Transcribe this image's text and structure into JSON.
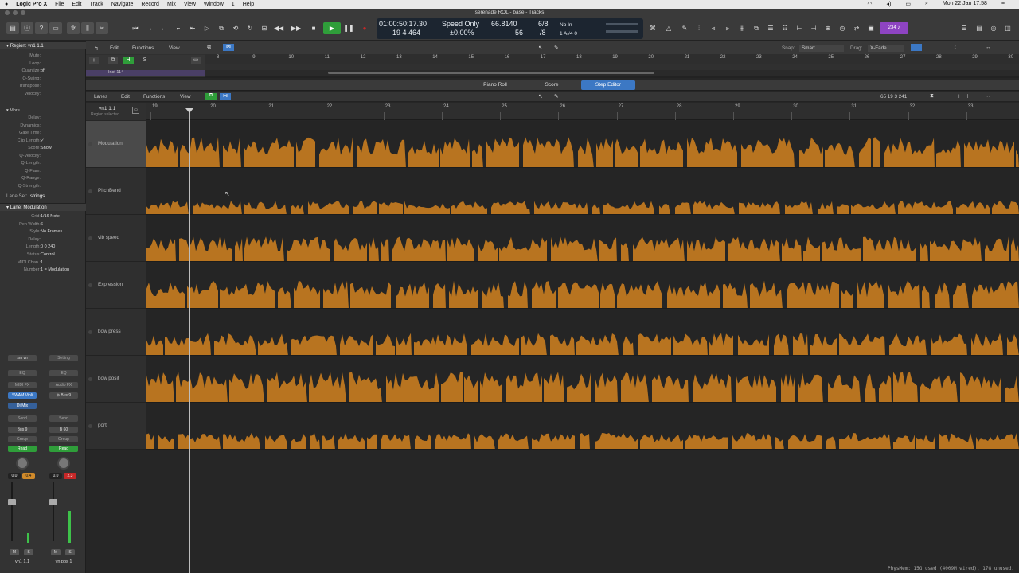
{
  "menubar": {
    "apple": "",
    "app": "Logic Pro X",
    "items": [
      "File",
      "Edit",
      "Track",
      "Navigate",
      "Record",
      "Mix",
      "View",
      "Window",
      "1",
      "Help"
    ],
    "clock": "Mon 22 Jan 17:58"
  },
  "window": {
    "title": "serenade ROL - base - Tracks"
  },
  "lcd": {
    "time": "01:00:50:17.30",
    "bars": "19  4  464",
    "mode": "Speed Only",
    "speed": "±0.00%",
    "tempo": "66.8140",
    "tempo2": "56",
    "sig": "6/8",
    "sig2": "/8",
    "input": "No In",
    "output": "1 A#4  0"
  },
  "transport": {
    "cpu": "234"
  },
  "region": {
    "header": "Region: vn1 1.1",
    "params": [
      {
        "k": "Mute:",
        "v": ""
      },
      {
        "k": "Loop:",
        "v": ""
      },
      {
        "k": "Quantize:",
        "v": "off"
      },
      {
        "k": "Q-Swing:",
        "v": ""
      },
      {
        "k": "Transpose:",
        "v": ""
      },
      {
        "k": "Velocity:",
        "v": ""
      }
    ],
    "more": "More",
    "more_params": [
      {
        "k": "Delay:",
        "v": ""
      },
      {
        "k": "Dynamics:",
        "v": ""
      },
      {
        "k": "Gate Time:",
        "v": ""
      },
      {
        "k": "Clip Length:",
        "v": "✓"
      },
      {
        "k": "Score:",
        "v": "Show"
      },
      {
        "k": "Q-Velocity:",
        "v": ""
      },
      {
        "k": "Q-Length:",
        "v": ""
      },
      {
        "k": "Q-Flam:",
        "v": ""
      },
      {
        "k": "Q-Range:",
        "v": ""
      },
      {
        "k": "Q-Strength:",
        "v": ""
      }
    ],
    "lane_set_label": "Lane Set:",
    "lane_set": "strings"
  },
  "lane_inspector": {
    "header": "Lane: Modulation",
    "params": [
      {
        "k": "Grid:",
        "v": "1/16 Note"
      },
      {
        "k": "Pen Width:",
        "v": "6"
      },
      {
        "k": "Style:",
        "v": "No Frames"
      },
      {
        "k": "Delay:",
        "v": ""
      },
      {
        "k": "Length:",
        "v": "0  0 240"
      },
      {
        "k": "Status:",
        "v": "Control"
      },
      {
        "k": "MIDI Chan.:",
        "v": "1"
      },
      {
        "k": "Number:",
        "v": "1 = Modulation"
      }
    ]
  },
  "strips": [
    {
      "setting": "sm vn",
      "eq": "EQ",
      "midifx": "MIDI FX",
      "inst": "SWAM Violi",
      "fx": "DirMix",
      "send": "Send",
      "bus": "Bus 9",
      "group": "Group",
      "auto": "Read",
      "vol": "0.0",
      "pan": "0.4",
      "m": "M",
      "s": "S",
      "name": "vn1 1.1"
    },
    {
      "setting": "Setting",
      "eq": "EQ",
      "midifx": "Audio FX",
      "inst": "Bus 9",
      "fx": "",
      "send": "Send",
      "bus": "B 60",
      "group": "Group",
      "auto": "Read",
      "vol": "0.0",
      "pan": "2.3",
      "m": "M",
      "s": "S",
      "name": "vn pos 1"
    }
  ],
  "tracks": {
    "menus": [
      "Edit",
      "Functions",
      "View"
    ],
    "snap_label": "Snap:",
    "snap": "Smart",
    "drag_label": "Drag:",
    "drag": "X-Fade",
    "track_name": "Inst 114",
    "ruler": [
      "8",
      "9",
      "10",
      "11",
      "12",
      "13",
      "14",
      "15",
      "16",
      "17",
      "18",
      "19",
      "20",
      "21",
      "22",
      "23",
      "24",
      "25",
      "26",
      "27",
      "28",
      "29",
      "30"
    ]
  },
  "tabs": [
    "Piano Roll",
    "Score",
    "Step Editor"
  ],
  "editor": {
    "menus": [
      "Lanes",
      "Edit",
      "Functions",
      "View"
    ],
    "position": "65  19  3  241",
    "region_name": "vn1 1.1",
    "region_sel": "Region selected",
    "ruler": [
      "19",
      "20",
      "21",
      "22",
      "23",
      "24",
      "25",
      "26",
      "27",
      "28",
      "29",
      "30",
      "31",
      "32",
      "33"
    ]
  },
  "lanes": [
    "Modulation",
    "PitchBend",
    "vib speed",
    "Expression",
    "bow press",
    "bow posit",
    "port"
  ],
  "status": "PhysMem: 15G used (4009M wired), 17G unused.",
  "colors": {
    "event": "#b87420",
    "accent": "#3c78c4",
    "play": "#2f9e3a",
    "record": "#c62828"
  }
}
